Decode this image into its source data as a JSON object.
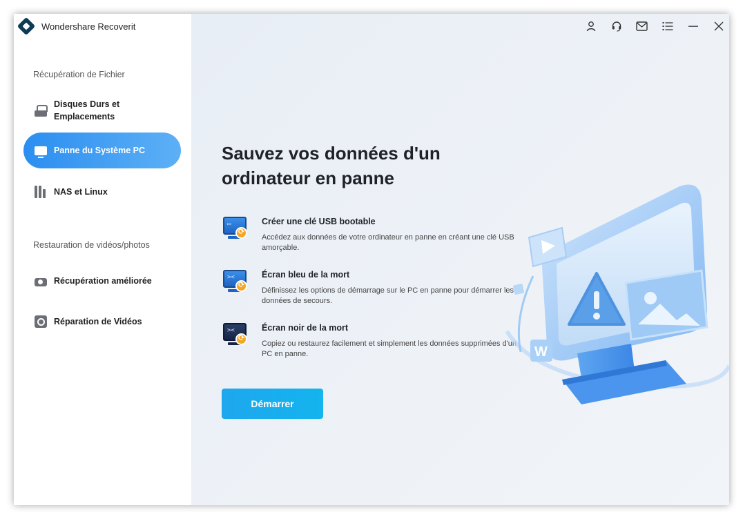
{
  "app": {
    "title": "Wondershare Recoverit"
  },
  "sidebar": {
    "section1": "Récupération de Fichier",
    "section2": "Restauration de vidéos/photos",
    "items": [
      {
        "label": "Disques Durs et Emplacements",
        "icon": "hard-drive-icon",
        "active": false
      },
      {
        "label": "Panne du Système PC",
        "icon": "monitor-icon",
        "active": true
      },
      {
        "label": "NAS et Linux",
        "icon": "nas-icon",
        "active": false
      },
      {
        "label": "Récupération améliorée",
        "icon": "camera-icon",
        "active": false
      },
      {
        "label": "Réparation de Vidéos",
        "icon": "video-repair-icon",
        "active": false
      }
    ]
  },
  "topbar": {
    "icons": [
      "user-icon",
      "support-icon",
      "mail-icon",
      "menu-icon",
      "minimize-icon",
      "close-icon"
    ]
  },
  "main": {
    "headline": "Sauvez vos données d'un ordinateur en panne",
    "features": [
      {
        "title": "Créer une clé USB bootable",
        "desc": "Accédez aux données de votre ordinateur en panne en créant une clé USB amorçable.",
        "icon": "usb-bootable-icon"
      },
      {
        "title": "Écran bleu de la mort",
        "desc": "Définissez les options de démarrage sur le PC en panne pour démarrer les données de secours.",
        "icon": "blue-screen-icon"
      },
      {
        "title": "Écran noir de la mort",
        "desc": "Copiez ou restaurez facilement et simplement les données supprimées d'un PC en panne.",
        "icon": "black-screen-icon"
      }
    ],
    "start_label": "Démarrer"
  },
  "colors": {
    "accent": "#2b8ef0",
    "button": "#1ea7ee",
    "main_bg": "#e9eef6"
  }
}
